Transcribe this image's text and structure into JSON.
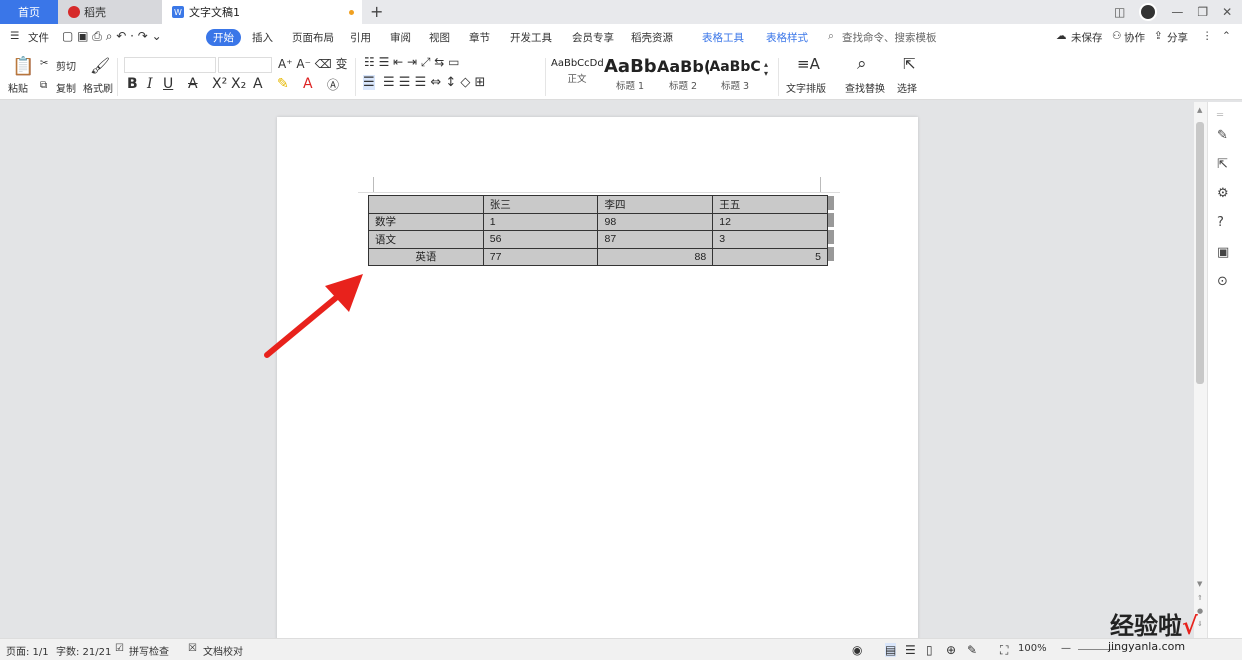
{
  "tabs": {
    "home": "首页",
    "daoke": "稻壳",
    "doc": "文字文稿1"
  },
  "menu": {
    "file": "文件",
    "start": "开始",
    "insert": "插入",
    "layout": "页面布局",
    "ref": "引用",
    "review": "审阅",
    "view": "视图",
    "chapter": "章节",
    "dev": "开发工具",
    "member": "会员专享",
    "daoke_res": "稻壳资源",
    "table_tools": "表格工具",
    "table_style": "表格样式",
    "search_placeholder": "查找命令、搜索模板",
    "unsaved": "未保存",
    "collab": "协作",
    "share": "分享"
  },
  "ribbon": {
    "paste": "粘贴",
    "cut": "剪切",
    "copy": "复制",
    "format_painter": "格式刷",
    "styles": [
      {
        "sample": "AaBbCcDd",
        "label": "正文"
      },
      {
        "sample": "AaBb",
        "label": "标题 1"
      },
      {
        "sample": "AaBb(",
        "label": "标题 2"
      },
      {
        "sample": "AaBbC",
        "label": "标题 3"
      }
    ],
    "text_layout": "文字排版",
    "find_replace": "查找替换",
    "select": "选择"
  },
  "table": {
    "header": [
      "",
      "张三",
      "李四",
      "王五"
    ],
    "rows": [
      [
        "数学",
        "1",
        "98",
        "12"
      ],
      [
        "语文",
        "56",
        "87",
        "3"
      ],
      [
        "英语",
        "77",
        "88",
        "5"
      ]
    ]
  },
  "status": {
    "page": "页面: 1/1",
    "words": "字数: 21/21",
    "spell": "拼写检查",
    "proof": "文档校对",
    "zoom": "100%"
  },
  "watermark": {
    "main": "经验啦",
    "sub": "jingyanla.com"
  },
  "colors": {
    "accent": "#3a76e8",
    "arrow": "#e8221c"
  }
}
